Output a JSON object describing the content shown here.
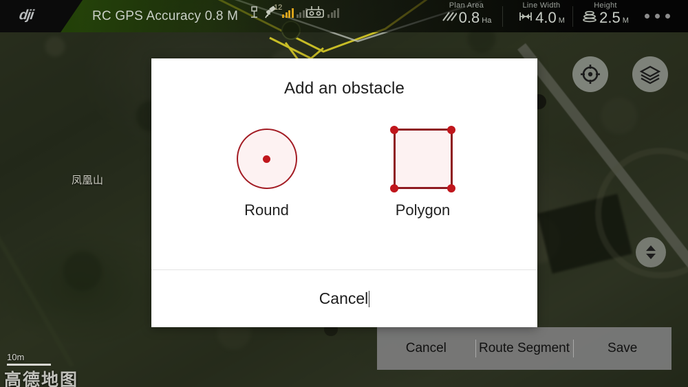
{
  "topbar": {
    "brand": "dji",
    "gps_status": "RC GPS Accuracy 0.8 M",
    "satellite_count": "12",
    "icons": {
      "satellite": "satellite-icon",
      "remote_controller": "remote-controller-icon",
      "signal_bars": "signal-bars-icon"
    },
    "telemetry": [
      {
        "label": "Plan Area",
        "value": "0.8",
        "unit": "Ha",
        "icon": "hatched-area-icon"
      },
      {
        "label": "Line Width",
        "value": "4.0",
        "unit": "M",
        "icon": "width-measure-icon"
      },
      {
        "label": "Height",
        "value": "2.5",
        "unit": "M",
        "icon": "altitude-layers-icon"
      }
    ],
    "more_menu": "more-options-icon"
  },
  "map": {
    "label": "凤凰山",
    "scale": "10m",
    "attribution": "高德地图",
    "controls": [
      {
        "name": "locate-button",
        "icon": "crosshair-icon"
      },
      {
        "name": "layers-button",
        "icon": "layers-icon"
      },
      {
        "name": "altitude-button",
        "icon": "up-down-arrows-icon"
      }
    ]
  },
  "dialog": {
    "title": "Add an obstacle",
    "options": [
      {
        "id": "round",
        "label": "Round",
        "icon": "circle-obstacle-icon"
      },
      {
        "id": "polygon",
        "label": "Polygon",
        "icon": "polygon-obstacle-icon"
      }
    ],
    "cancel_label": "Cancel"
  },
  "bottom_toolbar": {
    "buttons": [
      {
        "id": "cancel",
        "label": "Cancel"
      },
      {
        "id": "route-segment",
        "label": "Route Segment"
      },
      {
        "id": "save",
        "label": "Save"
      }
    ]
  },
  "colors": {
    "accent_red": "#c0161c",
    "outline_red": "#8e1a20",
    "dialog_bg": "#ffffff",
    "toolbar_bg": "#7c7c7c",
    "brand_green": "#264808",
    "signal_amber": "#d8a21b"
  }
}
